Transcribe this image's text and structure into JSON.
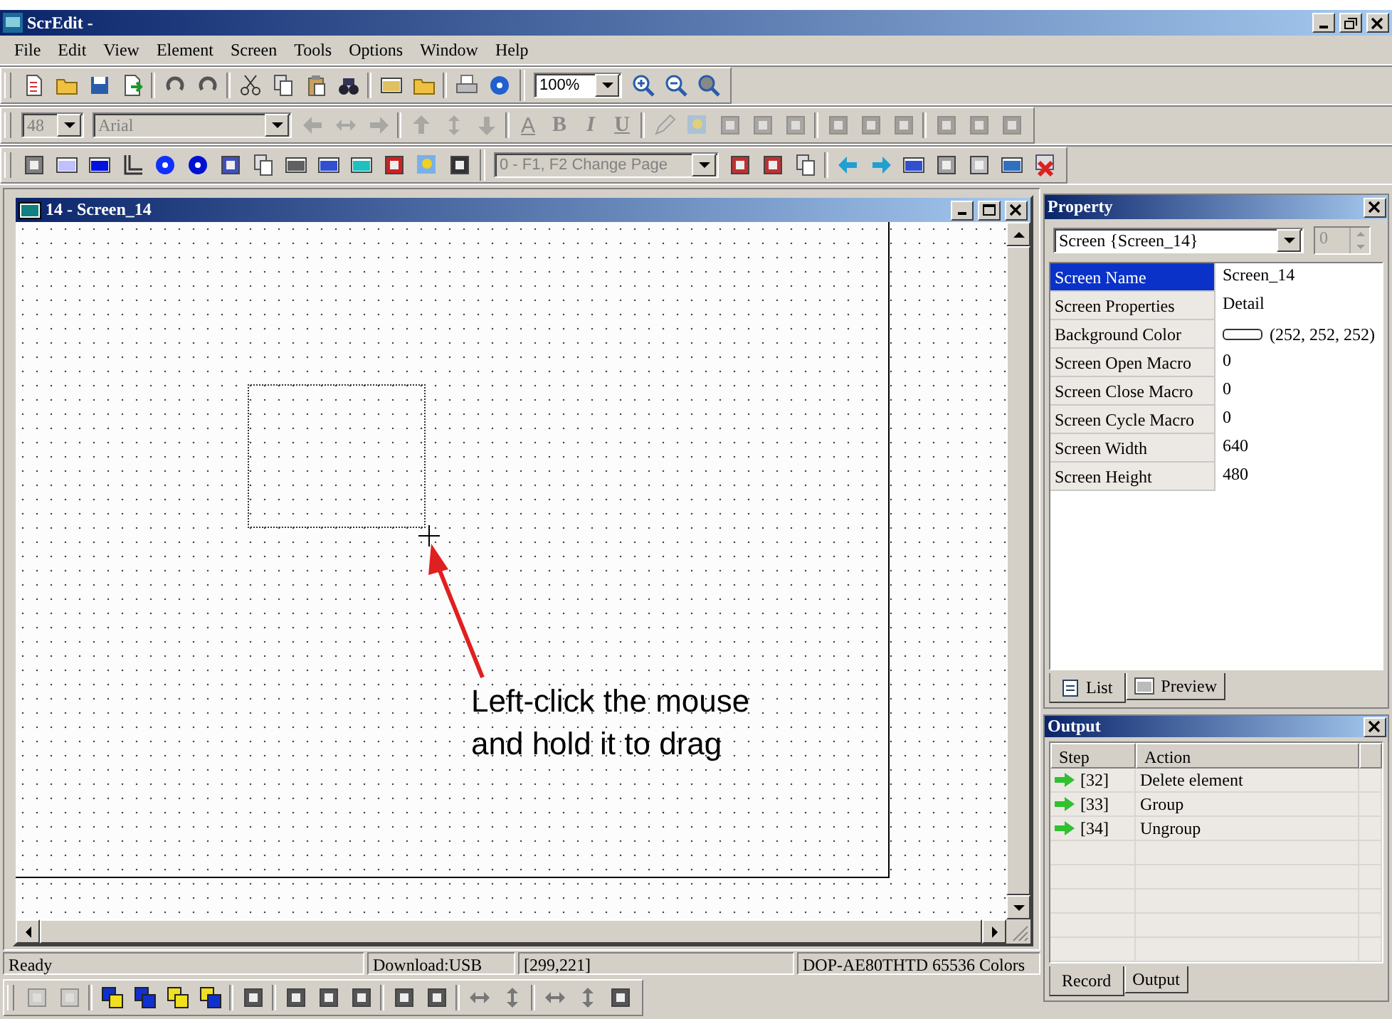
{
  "window": {
    "title": "ScrEdit -"
  },
  "menu": [
    "File",
    "Edit",
    "View",
    "Element",
    "Screen",
    "Tools",
    "Options",
    "Window",
    "Help"
  ],
  "zoom_select": {
    "value": "100%"
  },
  "format_bar": {
    "disabled": true,
    "font_size": "48",
    "font": "Arial",
    "text_buttons": [
      "A",
      "B",
      "I",
      "U"
    ]
  },
  "page_select": {
    "value": "0 - F1, F2  Change Page",
    "disabled": true
  },
  "screen_window": {
    "title": "14 - Screen_14"
  },
  "annotation": {
    "lines": [
      "Left-click the mouse",
      "and hold it to drag"
    ]
  },
  "property": {
    "title": "Property",
    "object": "Screen {Screen_14}",
    "index": "0",
    "rows": [
      {
        "name": "Screen Name",
        "value": "Screen_14",
        "selected": true,
        "kind": "text"
      },
      {
        "name": "Screen Properties",
        "value": "Detail",
        "selected": false,
        "kind": "text"
      },
      {
        "name": "Background Color",
        "value": "(252, 252, 252)",
        "selected": false,
        "kind": "color"
      },
      {
        "name": "Screen Open Macro",
        "value": "0",
        "selected": false,
        "kind": "text"
      },
      {
        "name": "Screen Close Macro",
        "value": "0",
        "selected": false,
        "kind": "text"
      },
      {
        "name": "Screen Cycle Macro",
        "value": "0",
        "selected": false,
        "kind": "text"
      },
      {
        "name": "Screen Width",
        "value": "640",
        "selected": false,
        "kind": "text"
      },
      {
        "name": "Screen Height",
        "value": "480",
        "selected": false,
        "kind": "text"
      }
    ],
    "tabs": [
      {
        "label": "List",
        "selected": true
      },
      {
        "label": "Preview",
        "selected": false
      }
    ]
  },
  "output": {
    "title": "Output",
    "columns": [
      "Step",
      "Action"
    ],
    "rows": [
      {
        "step": "[32]",
        "action": "Delete element"
      },
      {
        "step": "[33]",
        "action": "Group"
      },
      {
        "step": "[34]",
        "action": "Ungroup"
      }
    ],
    "tabs": [
      {
        "label": "Record",
        "selected": true
      },
      {
        "label": "Output",
        "selected": false
      }
    ]
  },
  "status_bar": [
    "Ready",
    "Download:USB",
    "[299,221]",
    "DOP-AE80THTD 65536 Colors"
  ]
}
